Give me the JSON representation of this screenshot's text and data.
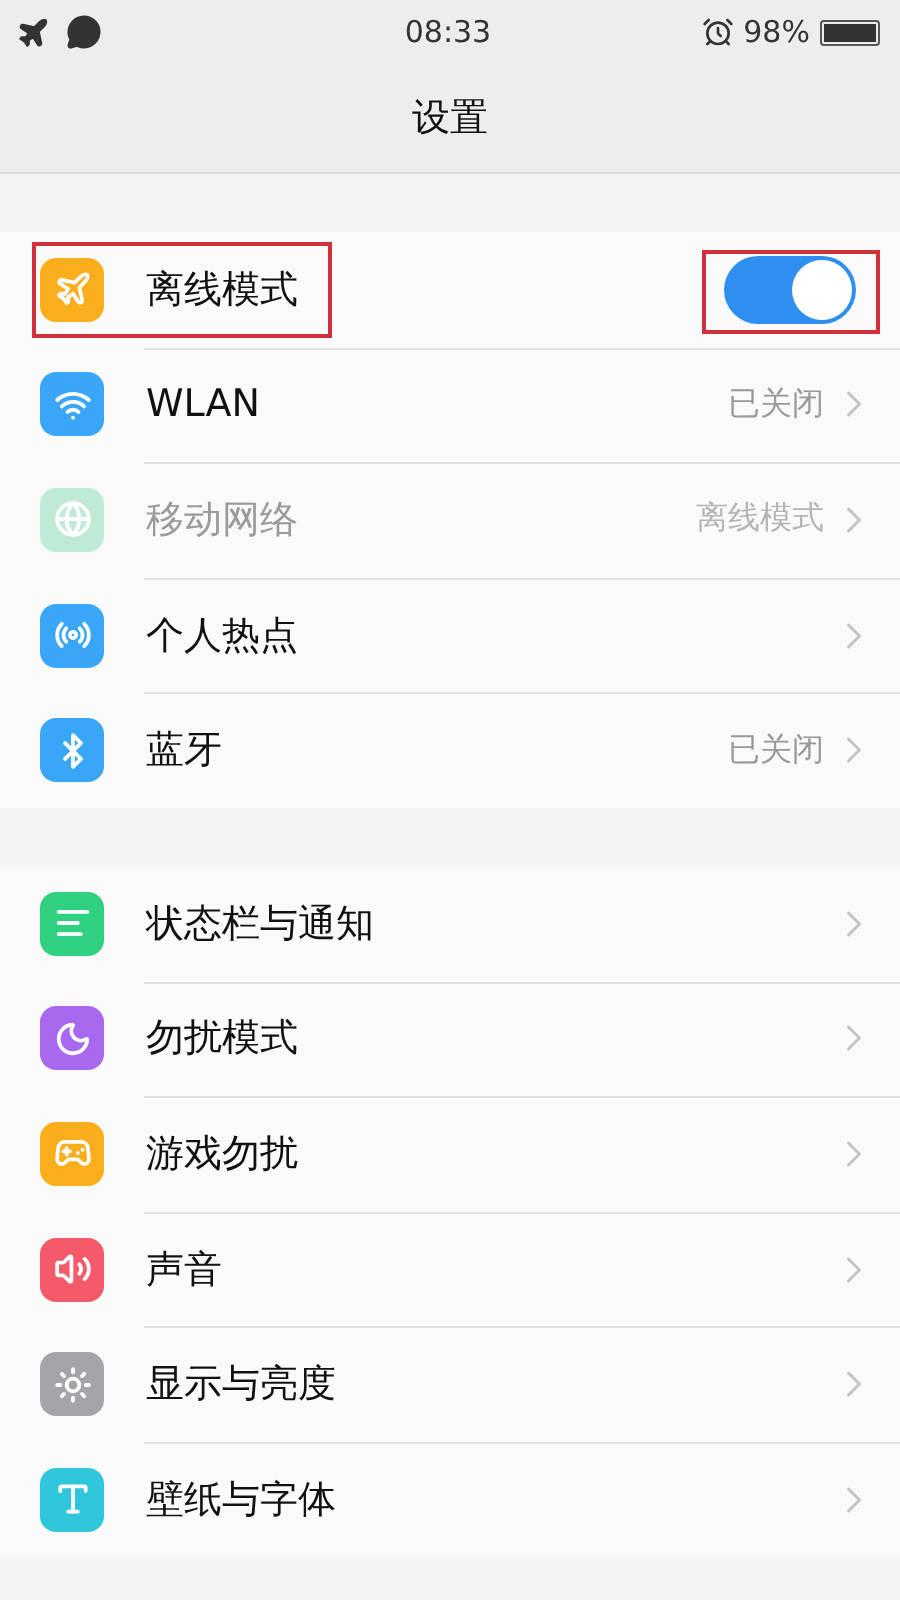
{
  "status_bar": {
    "time": "08:33",
    "battery": "98%"
  },
  "header": {
    "title": "设置"
  },
  "groups": [
    {
      "items": [
        {
          "color": "#fbae1c",
          "label": "离线模式",
          "kind": "toggle",
          "on": true,
          "disabled": false,
          "annotated": true
        },
        {
          "color": "#3aa6f8",
          "label": "WLAN",
          "kind": "link",
          "value": "已关闭",
          "disabled": false,
          "annotated": false
        },
        {
          "color": "#bfebd6",
          "label": "移动网络",
          "kind": "link",
          "value": "离线模式",
          "disabled": true,
          "annotated": false
        },
        {
          "color": "#3aa6f8",
          "label": "个人热点",
          "kind": "link",
          "disabled": false,
          "annotated": false
        },
        {
          "color": "#3aa6f8",
          "label": "蓝牙",
          "kind": "link",
          "value": "已关闭",
          "disabled": false,
          "annotated": false
        }
      ]
    },
    {
      "items": [
        {
          "color": "#2fd07f",
          "label": "状态栏与通知",
          "kind": "link",
          "disabled": false,
          "annotated": false
        },
        {
          "color": "#a769f0",
          "label": "勿扰模式",
          "kind": "link",
          "disabled": false,
          "annotated": false
        },
        {
          "color": "#fbae1c",
          "label": "游戏勿扰",
          "kind": "link",
          "disabled": false,
          "annotated": false
        },
        {
          "color": "#f45a6a",
          "label": "声音",
          "kind": "link",
          "disabled": false,
          "annotated": false
        },
        {
          "color": "#a4a4aa",
          "label": "显示与亮度",
          "kind": "link",
          "disabled": false,
          "annotated": false
        },
        {
          "color": "#2fc6dc",
          "label": "壁纸与字体",
          "kind": "link",
          "disabled": false,
          "annotated": false
        }
      ]
    }
  ]
}
